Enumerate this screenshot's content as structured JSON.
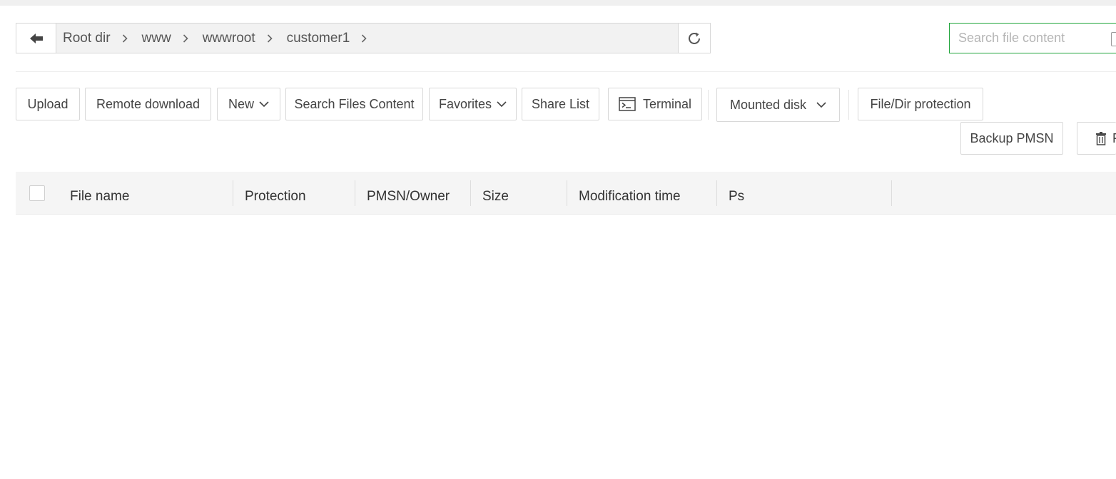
{
  "path_bar": {
    "back_icon": "arrow-left-icon",
    "crumbs": [
      "Root dir",
      "www",
      "wwwroot",
      "customer1"
    ],
    "separator_icon": "chevron-right-icon",
    "refresh_icon": "refresh-icon"
  },
  "search": {
    "placeholder": "Search file content"
  },
  "toolbar": {
    "upload": "Upload",
    "remote_download": "Remote download",
    "new": "New",
    "search_files_content": "Search Files Content",
    "favorites": "Favorites",
    "share_list": "Share List",
    "terminal": "Terminal",
    "mounted_disk": "Mounted disk",
    "file_dir_protection": "File/Dir protection",
    "backup_pmsn": "Backup PMSN",
    "recycle_partial": "F"
  },
  "table": {
    "columns": [
      "File name",
      "Protection",
      "PMSN/Owner",
      "Size",
      "Modification time",
      "Ps"
    ]
  },
  "colors": {
    "accent": "#20a53a",
    "border": "#d8d8d8",
    "header_bg": "#f5f5f5"
  }
}
